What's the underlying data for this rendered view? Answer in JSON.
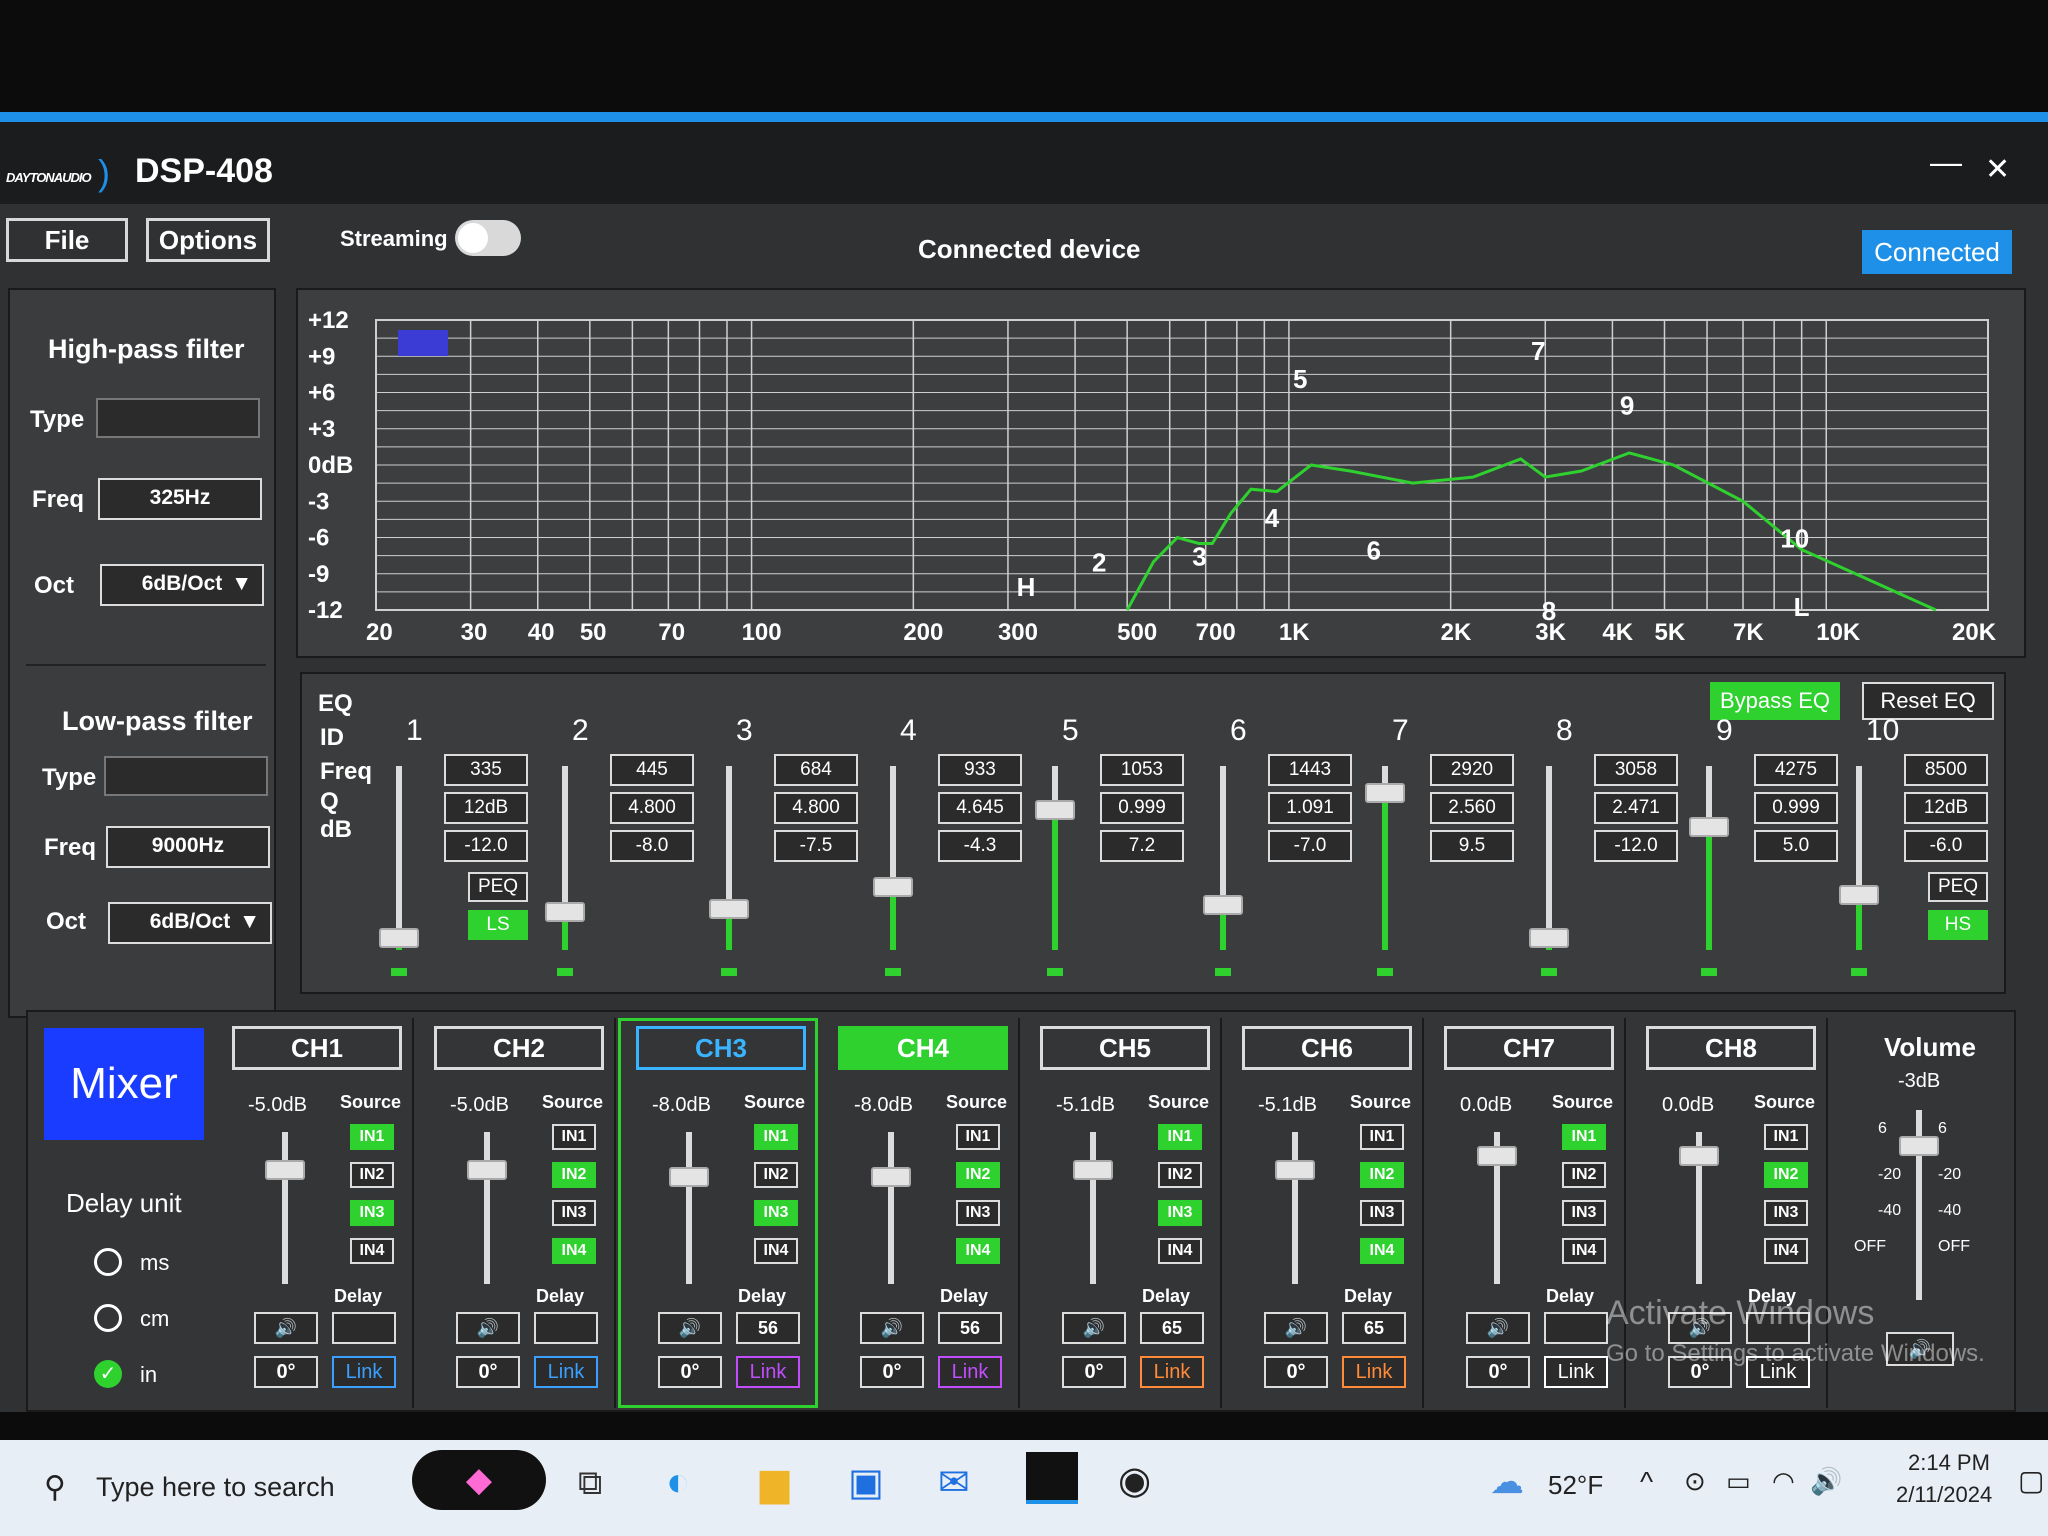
{
  "app": {
    "logo": "DAYTONAUDIO",
    "title": "DSP-408",
    "minimize": "—",
    "close": "✕"
  },
  "menu": {
    "file": "File",
    "options": "Options",
    "streaming": "Streaming",
    "connected_device": "Connected device",
    "connected": "Connected"
  },
  "hpf": {
    "title": "High-pass filter",
    "type_label": "Type",
    "type_value": "",
    "freq_label": "Freq",
    "freq_value": "325Hz",
    "oct_label": "Oct",
    "oct_value": "6dB/Oct"
  },
  "lpf": {
    "title": "Low-pass filter",
    "type_label": "Type",
    "type_value": "",
    "freq_label": "Freq",
    "freq_value": "9000Hz",
    "oct_label": "Oct",
    "oct_value": "6dB/Oct"
  },
  "graph": {
    "y_ticks": [
      "+12",
      "+9",
      "+6",
      "+3",
      "0dB",
      "-3",
      "-6",
      "-9",
      "-12"
    ],
    "x_ticks": [
      "20",
      "30",
      "40",
      "50",
      "70",
      "100",
      "200",
      "300",
      "500",
      "700",
      "1K",
      "2K",
      "3K",
      "4K",
      "5K",
      "7K",
      "10K",
      "20K"
    ],
    "x_values": [
      20,
      30,
      40,
      50,
      70,
      100,
      200,
      300,
      500,
      700,
      1000,
      2000,
      3000,
      4000,
      5000,
      7000,
      10000,
      20000
    ],
    "y_values": [
      12,
      9,
      6,
      3,
      0,
      -3,
      -6,
      -9,
      -12
    ],
    "curve": [
      [
        500,
        -12
      ],
      [
        560,
        -8
      ],
      [
        620,
        -6
      ],
      [
        680,
        -6.5
      ],
      [
        720,
        -6.5
      ],
      [
        780,
        -4
      ],
      [
        850,
        -2
      ],
      [
        950,
        -2.2
      ],
      [
        1100,
        0
      ],
      [
        1300,
        -0.5
      ],
      [
        1700,
        -1.5
      ],
      [
        2200,
        -1
      ],
      [
        2700,
        0.5
      ],
      [
        3000,
        -1
      ],
      [
        3500,
        -0.5
      ],
      [
        4300,
        1
      ],
      [
        5200,
        0
      ],
      [
        7000,
        -3
      ],
      [
        9000,
        -7
      ],
      [
        12000,
        -9.5
      ],
      [
        16000,
        -12
      ]
    ],
    "band_markers": [
      {
        "label": "2",
        "freq": 445,
        "db": -8
      },
      {
        "label": "3",
        "freq": 684,
        "db": -7.5
      },
      {
        "label": "4",
        "freq": 933,
        "db": -4.3
      },
      {
        "label": "5",
        "freq": 1053,
        "db": 7.2
      },
      {
        "label": "6",
        "freq": 1443,
        "db": -7
      },
      {
        "label": "7",
        "freq": 2920,
        "db": 9.5
      },
      {
        "label": "8",
        "freq": 3058,
        "db": -12
      },
      {
        "label": "9",
        "freq": 4275,
        "db": 5
      },
      {
        "label": "10",
        "freq": 8500,
        "db": -6
      }
    ],
    "hp_marker": {
      "label": "H",
      "freq": 325
    },
    "lp_marker": {
      "label": "L",
      "freq": 9000
    }
  },
  "eq": {
    "title": "EQ",
    "bypass": "Bypass EQ",
    "reset": "Reset EQ",
    "row_labels": {
      "id": "ID",
      "freq": "Freq",
      "q": "Q",
      "db": "dB"
    },
    "bands": [
      {
        "id": "1",
        "freq": "335",
        "q": "12dB",
        "db": "-12.0",
        "peq": "PEQ",
        "type": "LS",
        "level": 0.05
      },
      {
        "id": "2",
        "freq": "445",
        "q": "4.800",
        "db": "-8.0",
        "level": 0.2
      },
      {
        "id": "3",
        "freq": "684",
        "q": "4.800",
        "db": "-7.5",
        "level": 0.22
      },
      {
        "id": "4",
        "freq": "933",
        "q": "4.645",
        "db": "-4.3",
        "level": 0.35
      },
      {
        "id": "5",
        "freq": "1053",
        "q": "0.999",
        "db": "7.2",
        "level": 0.8
      },
      {
        "id": "6",
        "freq": "1443",
        "q": "1.091",
        "db": "-7.0",
        "level": 0.24
      },
      {
        "id": "7",
        "freq": "2920",
        "q": "2.560",
        "db": "9.5",
        "level": 0.9
      },
      {
        "id": "8",
        "freq": "3058",
        "q": "2.471",
        "db": "-12.0",
        "level": 0.05
      },
      {
        "id": "9",
        "freq": "4275",
        "q": "0.999",
        "db": "5.0",
        "level": 0.7
      },
      {
        "id": "10",
        "freq": "8500",
        "q": "12dB",
        "db": "-6.0",
        "peq": "PEQ",
        "type": "HS",
        "level": 0.3
      }
    ]
  },
  "mixer": {
    "title": "Mixer",
    "delay_unit": "Delay unit",
    "units": [
      {
        "label": "ms",
        "checked": false
      },
      {
        "label": "cm",
        "checked": false
      },
      {
        "label": "in",
        "checked": true
      }
    ],
    "source_label": "Source",
    "delay_label": "Delay",
    "phase": "0°",
    "link": "Link",
    "channels": [
      {
        "name": "CH1",
        "gain": "-5.0dB",
        "sources": [
          true,
          false,
          true,
          false
        ],
        "delay": "",
        "link_color": "#3aa0ff",
        "state": "normal",
        "level": 0.8
      },
      {
        "name": "CH2",
        "gain": "-5.0dB",
        "sources": [
          false,
          true,
          false,
          true
        ],
        "delay": "",
        "link_color": "#3aa0ff",
        "state": "normal",
        "level": 0.8
      },
      {
        "name": "CH3",
        "gain": "-8.0dB",
        "sources": [
          true,
          false,
          true,
          false
        ],
        "delay": "56",
        "link_color": "#c24dff",
        "state": "selected",
        "level": 0.75
      },
      {
        "name": "CH4",
        "gain": "-8.0dB",
        "sources": [
          false,
          true,
          false,
          true
        ],
        "delay": "56",
        "link_color": "#c24dff",
        "state": "green",
        "level": 0.75
      },
      {
        "name": "CH5",
        "gain": "-5.1dB",
        "sources": [
          true,
          false,
          true,
          false
        ],
        "delay": "65",
        "link_color": "#ff8a3a",
        "state": "normal",
        "level": 0.8
      },
      {
        "name": "CH6",
        "gain": "-5.1dB",
        "sources": [
          false,
          true,
          false,
          true
        ],
        "delay": "65",
        "link_color": "#ff8a3a",
        "state": "normal",
        "level": 0.8
      },
      {
        "name": "CH7",
        "gain": "0.0dB",
        "sources": [
          true,
          false,
          false,
          false
        ],
        "delay": "",
        "link_color": "#ffffff",
        "state": "normal",
        "level": 0.9
      },
      {
        "name": "CH8",
        "gain": "0.0dB",
        "sources": [
          false,
          true,
          false,
          false
        ],
        "delay": "",
        "link_color": "#ffffff",
        "state": "normal",
        "level": 0.9
      }
    ],
    "source_names": [
      "IN1",
      "IN2",
      "IN3",
      "IN4"
    ]
  },
  "volume": {
    "title": "Volume",
    "value": "-3dB",
    "scale_left": [
      "6",
      "-20",
      "-40",
      "OFF"
    ],
    "scale_right": [
      "6",
      "-20",
      "-40",
      "OFF"
    ],
    "level": 0.85
  },
  "watermark": {
    "line1": "Activate Windows",
    "line2": "Go to Settings to activate Windows."
  },
  "taskbar": {
    "search_placeholder": "Type here to search",
    "weather": "52°F",
    "time": "2:14 PM",
    "date": "2/11/2024"
  },
  "colors": {
    "accent": "#1e90e8",
    "green": "#2ed12e",
    "mixer_blue": "#1a3cff"
  }
}
